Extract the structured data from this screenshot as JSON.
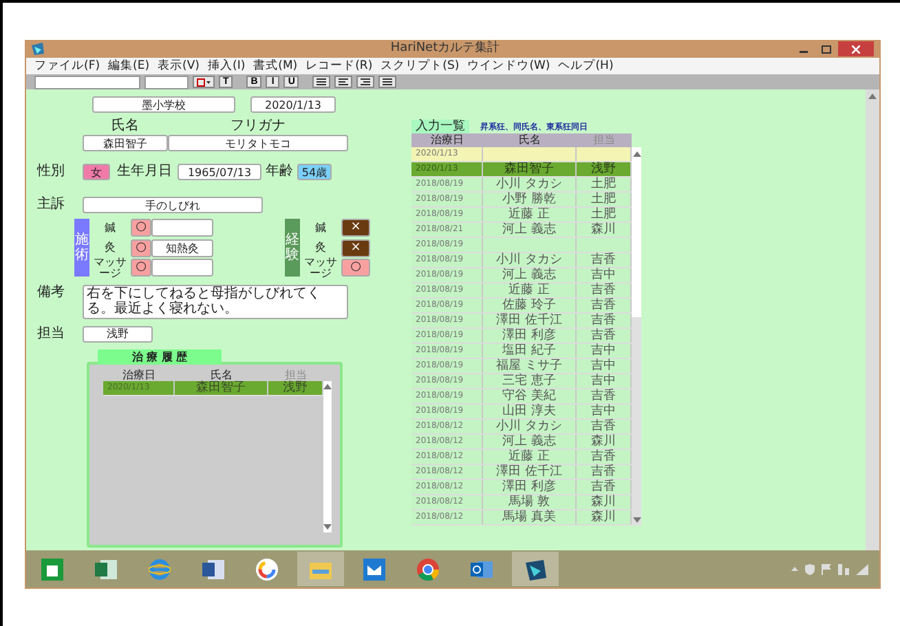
{
  "window": {
    "title": "HariNetカルテ集計"
  },
  "menu": [
    "ファイル(F)",
    "編集(E)",
    "表示(V)",
    "挿入(I)",
    "書式(M)",
    "レコード(R)",
    "スクリプト(S)",
    "ウインドウ(W)",
    "ヘルプ(H)"
  ],
  "toolbar": {
    "style_button": "T",
    "format_buttons": [
      "B",
      "I",
      "U"
    ]
  },
  "form": {
    "school": "墨小学校",
    "date": "2020/1/13",
    "name": {
      "label": "氏名",
      "value": "森田智子"
    },
    "kana": {
      "label": "フリガナ",
      "value": "モリタトモコ"
    },
    "sex": {
      "label": "性別",
      "value": "女"
    },
    "birth": {
      "label": "生年月日",
      "value": "1965/07/13"
    },
    "age": {
      "label": "年齢",
      "value": "54歳"
    },
    "complaint": {
      "label": "主訴",
      "value": "手のしびれ"
    },
    "treatment": {
      "label": "施術",
      "items": [
        {
          "label": "鍼",
          "mark": "○",
          "kind": "yes"
        },
        {
          "label": "灸",
          "mark": "○",
          "kind": "yes",
          "note": "知熱灸"
        },
        {
          "label": "マッサージ",
          "mark": "○",
          "kind": "yes"
        }
      ]
    },
    "experience": {
      "label": "経験",
      "items": [
        {
          "label": "鍼",
          "mark": "×",
          "kind": "no"
        },
        {
          "label": "灸",
          "mark": "×",
          "kind": "no"
        },
        {
          "label": "マッサージ",
          "mark": "○",
          "kind": "yes"
        }
      ]
    },
    "remarks": {
      "label": "備考",
      "value": "右を下にしてねると母指がしびれてくる。最近よく寝れない。"
    },
    "staff": {
      "label": "担当",
      "value": "浅野"
    }
  },
  "history": {
    "title": "治 療 履 歴",
    "columns": [
      {
        "label": "治療日",
        "muted": false
      },
      {
        "label": "氏名",
        "muted": false
      },
      {
        "label": "担当",
        "muted": true
      }
    ],
    "rows": [
      {
        "date": "2020/1/13",
        "name": "森田智子",
        "staff": "浅野",
        "selected": true
      }
    ]
  },
  "list": {
    "title": "入力一覧",
    "sort_note": "昇系狂、同氏名、東系狂同日",
    "columns": [
      {
        "label": "治療日",
        "muted": false
      },
      {
        "label": "氏名",
        "muted": false
      },
      {
        "label": "担当",
        "muted": true
      }
    ],
    "rows": [
      {
        "kind": "new",
        "date": "2020/1/13",
        "selected": false
      },
      {
        "kind": "record",
        "date": "2020/1/13",
        "name": "森田智子",
        "staff": "浅野",
        "selected": true
      },
      {
        "kind": "record",
        "date": "2018/08/19",
        "name": "小川 タカシ",
        "staff": "土肥",
        "selected": false
      },
      {
        "kind": "record",
        "date": "2018/08/19",
        "name": "小野 勝乾",
        "staff": "土肥",
        "selected": false
      },
      {
        "kind": "record",
        "date": "2018/08/19",
        "name": "近藤 正",
        "staff": "土肥",
        "selected": false
      },
      {
        "kind": "record",
        "date": "2018/08/21",
        "name": "河上 義志",
        "staff": "森川",
        "selected": false
      },
      {
        "kind": "record",
        "date": "2018/08/19",
        "selected": false
      },
      {
        "kind": "record",
        "date": "2018/08/19",
        "name": "小川 タカシ",
        "staff": "吉香",
        "selected": false
      },
      {
        "kind": "record",
        "date": "2018/08/19",
        "name": "河上 義志",
        "staff": "吉中",
        "selected": false
      },
      {
        "kind": "record",
        "date": "2018/08/19",
        "name": "近藤 正",
        "staff": "吉香",
        "selected": false
      },
      {
        "kind": "record",
        "date": "2018/08/19",
        "name": "佐藤 玲子",
        "staff": "吉香",
        "selected": false
      },
      {
        "kind": "record",
        "date": "2018/08/19",
        "name": "澤田 佐千江",
        "staff": "吉香",
        "selected": false
      },
      {
        "kind": "record",
        "date": "2018/08/19",
        "name": "澤田 利彦",
        "staff": "吉香",
        "selected": false
      },
      {
        "kind": "record",
        "date": "2018/08/19",
        "name": "塩田 紀子",
        "staff": "吉中",
        "selected": false
      },
      {
        "kind": "record",
        "date": "2018/08/19",
        "name": "福屋 ミサ子",
        "staff": "吉中",
        "selected": false
      },
      {
        "kind": "record",
        "date": "2018/08/19",
        "name": "三宅 恵子",
        "staff": "吉中",
        "selected": false
      },
      {
        "kind": "record",
        "date": "2018/08/19",
        "name": "守谷 美紀",
        "staff": "吉香",
        "selected": false
      },
      {
        "kind": "record",
        "date": "2018/08/19",
        "name": "山田 淳夫",
        "staff": "吉中",
        "selected": false
      },
      {
        "kind": "record",
        "date": "2018/08/12",
        "name": "小川 タカシ",
        "staff": "吉香",
        "selected": false
      },
      {
        "kind": "record",
        "date": "2018/08/12",
        "name": "河上 義志",
        "staff": "森川",
        "selected": false
      },
      {
        "kind": "record",
        "date": "2018/08/12",
        "name": "近藤 正",
        "staff": "吉香",
        "selected": false
      },
      {
        "kind": "record",
        "date": "2018/08/12",
        "name": "澤田 佐千江",
        "staff": "吉香",
        "selected": false
      },
      {
        "kind": "record",
        "date": "2018/08/12",
        "name": "澤田 利彦",
        "staff": "吉香",
        "selected": false
      },
      {
        "kind": "record",
        "date": "2018/08/12",
        "name": "馬場 敦",
        "staff": "森川",
        "selected": false
      },
      {
        "kind": "record",
        "date": "2018/08/12",
        "name": "馬場 真美",
        "staff": "森川",
        "selected": false
      }
    ]
  },
  "taskbar": [
    {
      "kind": "store",
      "selected": false
    },
    {
      "kind": "excel",
      "selected": false
    },
    {
      "kind": "ie",
      "selected": false
    },
    {
      "kind": "word",
      "selected": false
    },
    {
      "kind": "google",
      "selected": false
    },
    {
      "kind": "folder",
      "selected": true
    },
    {
      "kind": "mail",
      "selected": false
    },
    {
      "kind": "chrome",
      "selected": false
    },
    {
      "kind": "outlook",
      "selected": false
    },
    {
      "kind": "app",
      "selected": true
    }
  ]
}
